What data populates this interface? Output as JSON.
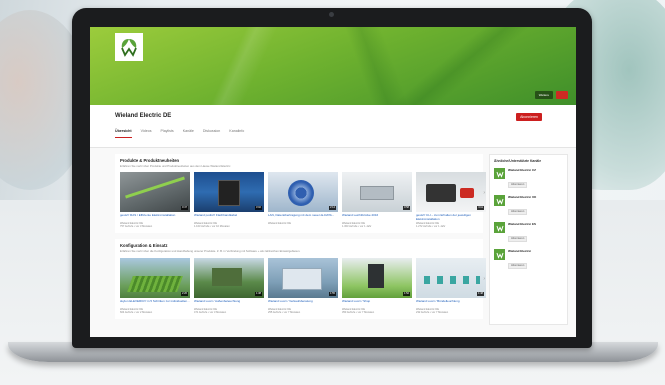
{
  "channel": {
    "name": "Wieland Electric DE",
    "subscribe_label": "Abonnieren",
    "banner_buttons": [
      "Weitere",
      ""
    ],
    "tabs": [
      "Übersicht",
      "Videos",
      "Playlists",
      "Kanäle",
      "Diskussion",
      "Kanalinfo"
    ],
    "active_tab": 0
  },
  "sections": [
    {
      "title": "Produkte & Produktneuheiten",
      "description": "Erfahren Sie mehr über Produkte und Produktneuheiten aus dem Hause Wieland Electric",
      "videos": [
        {
          "title": "gesis® RAS / Effiziente Elektroinstallation",
          "channel": "Wieland Electric DE",
          "meta": "757 Aufrufe • vor 3 Monaten",
          "duration": "0:47"
        },
        {
          "title": "Wieland podis® Flachbandkabel",
          "channel": "Wieland Electric DE",
          "meta": "1.103 Aufrufe • vor 10 Monaten",
          "duration": "3:02"
        },
        {
          "title": "LAN, Datenübertragung mit dem neuen E-DATA...",
          "channel": "Wieland Electric DE",
          "meta": "",
          "duration": "2:14"
        },
        {
          "title": "Wieland Leichtbrücke 2016",
          "channel": "Wieland Electric DE",
          "meta": "1.303 Aufrufe • vor 1 Jahr",
          "duration": "0:58"
        },
        {
          "title": "gesis® CLI – zum Erhalten der jeweiligen Elektroinstallation",
          "channel": "Wieland Electric DE",
          "meta": "1.272 Aufrufe • vor 1 Jahr",
          "duration": "4:11"
        }
      ]
    },
    {
      "title": "Konfiguration & Einsatz",
      "description": "Erfahren Sie mehr über die Konfiguration und Handhabung unserer Produkte. Z. B. in Verbindung mit Software + als zahlreichen Einsatzgebieten.",
      "videos": [
        {
          "title": "skylon ELEVERIC® in 5 Schritten zur individuellen...",
          "channel": "Wieland Electric DE",
          "meta": "604 Aufrufe • vor 2 Monaten",
          "duration": "2:26"
        },
        {
          "title": "Wieland Lucci / Außenbeleuchtung",
          "channel": "Wieland Electric DE",
          "meta": "471 Aufrufe • vor 3 Monaten",
          "duration": "1:38"
        },
        {
          "title": "Wieland Lucci / Verkaufsberatung",
          "channel": "Wieland Electric DE",
          "meta": "255 Aufrufe • vor 7 Monaten",
          "duration": "1:55"
        },
        {
          "title": "Wieland Lucci / Shop",
          "channel": "Wieland Electric DE",
          "meta": "353 Aufrufe • vor 7 Monaten",
          "duration": "1:52"
        },
        {
          "title": "Wieland Lucci / Bündelleuchtung",
          "channel": "Wieland Electric DE",
          "meta": "232 Aufrufe • vor 7 Monaten",
          "duration": "1:48"
        }
      ]
    }
  ],
  "sidebar": {
    "title": "Ähnliche/Unterstützte Kanäle",
    "channels": [
      {
        "name": "Wieland Electric CZ",
        "button": "Abonnieren"
      },
      {
        "name": "Wieland Electric UK",
        "button": "Abonnieren"
      },
      {
        "name": "Wieland Electric ES",
        "button": "Abonnieren"
      },
      {
        "name": "Wieland Electric",
        "button": "Abonnieren"
      }
    ]
  },
  "colors": {
    "brand_green": "#5aa33a",
    "subscribe_red": "#cc1f1f",
    "link_blue": "#1a5bb8"
  }
}
